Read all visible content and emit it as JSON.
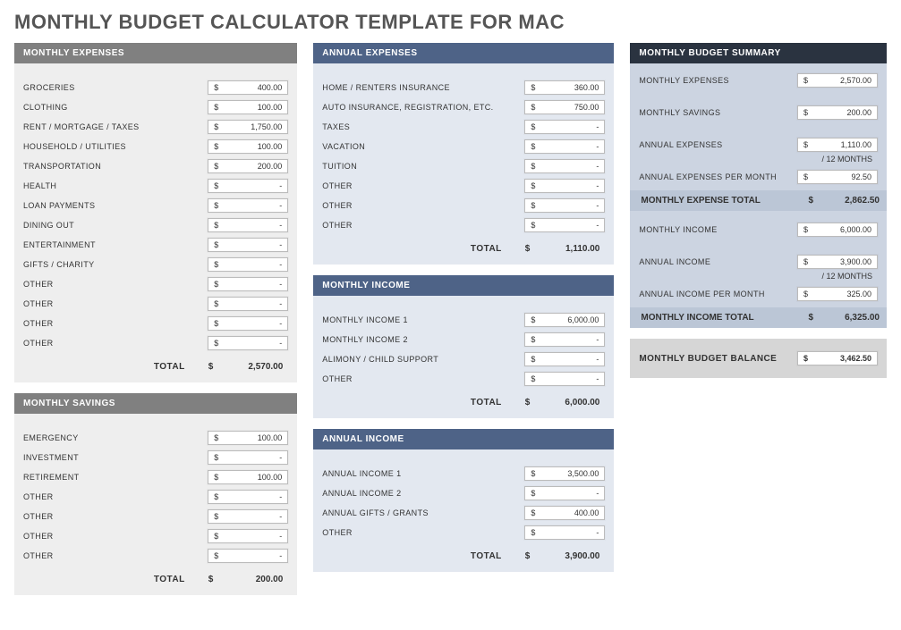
{
  "title": "MONTHLY BUDGET CALCULATOR TEMPLATE FOR MAC",
  "currency": "$",
  "dash": "-",
  "labels": {
    "total": "TOTAL",
    "per12": "/ 12 MONTHS"
  },
  "monthly_expenses": {
    "heading": "MONTHLY EXPENSES",
    "rows": [
      {
        "label": "GROCERIES",
        "value": "400.00"
      },
      {
        "label": "CLOTHING",
        "value": "100.00"
      },
      {
        "label": "RENT / MORTGAGE / TAXES",
        "value": "1,750.00"
      },
      {
        "label": "HOUSEHOLD / UTILITIES",
        "value": "100.00"
      },
      {
        "label": "TRANSPORTATION",
        "value": "200.00"
      },
      {
        "label": "HEALTH",
        "value": "-"
      },
      {
        "label": "LOAN PAYMENTS",
        "value": "-"
      },
      {
        "label": "DINING OUT",
        "value": "-"
      },
      {
        "label": "ENTERTAINMENT",
        "value": "-"
      },
      {
        "label": "GIFTS / CHARITY",
        "value": "-"
      },
      {
        "label": "OTHER",
        "value": "-"
      },
      {
        "label": "OTHER",
        "value": "-"
      },
      {
        "label": "OTHER",
        "value": "-"
      },
      {
        "label": "OTHER",
        "value": "-"
      }
    ],
    "total": "2,570.00"
  },
  "monthly_savings": {
    "heading": "MONTHLY SAVINGS",
    "rows": [
      {
        "label": "EMERGENCY",
        "value": "100.00"
      },
      {
        "label": "INVESTMENT",
        "value": "-"
      },
      {
        "label": "RETIREMENT",
        "value": "100.00"
      },
      {
        "label": "OTHER",
        "value": "-"
      },
      {
        "label": "OTHER",
        "value": "-"
      },
      {
        "label": "OTHER",
        "value": "-"
      },
      {
        "label": "OTHER",
        "value": "-"
      }
    ],
    "total": "200.00"
  },
  "annual_expenses": {
    "heading": "ANNUAL EXPENSES",
    "rows": [
      {
        "label": "HOME / RENTERS INSURANCE",
        "value": "360.00"
      },
      {
        "label": "AUTO INSURANCE, REGISTRATION, ETC.",
        "value": "750.00"
      },
      {
        "label": "TAXES",
        "value": "-"
      },
      {
        "label": "VACATION",
        "value": "-"
      },
      {
        "label": "TUITION",
        "value": "-"
      },
      {
        "label": "OTHER",
        "value": "-"
      },
      {
        "label": "OTHER",
        "value": "-"
      },
      {
        "label": "OTHER",
        "value": "-"
      }
    ],
    "total": "1,110.00"
  },
  "monthly_income": {
    "heading": "MONTHLY INCOME",
    "rows": [
      {
        "label": "MONTHLY INCOME 1",
        "value": "6,000.00"
      },
      {
        "label": "MONTHLY INCOME 2",
        "value": "-"
      },
      {
        "label": "ALIMONY / CHILD SUPPORT",
        "value": "-"
      },
      {
        "label": "OTHER",
        "value": "-"
      }
    ],
    "total": "6,000.00"
  },
  "annual_income": {
    "heading": "ANNUAL INCOME",
    "rows": [
      {
        "label": "ANNUAL INCOME 1",
        "value": "3,500.00"
      },
      {
        "label": "ANNUAL INCOME 2",
        "value": "-"
      },
      {
        "label": "ANNUAL GIFTS / GRANTS",
        "value": "400.00"
      },
      {
        "label": "OTHER",
        "value": "-"
      }
    ],
    "total": "3,900.00"
  },
  "summary": {
    "heading": "MONTHLY BUDGET SUMMARY",
    "monthly_expenses": {
      "label": "MONTHLY EXPENSES",
      "value": "2,570.00"
    },
    "monthly_savings": {
      "label": "MONTHLY SAVINGS",
      "value": "200.00"
    },
    "annual_expenses": {
      "label": "ANNUAL EXPENSES",
      "value": "1,110.00"
    },
    "annual_expenses_pm": {
      "label": "ANNUAL EXPENSES PER MONTH",
      "value": "92.50"
    },
    "expense_total": {
      "label": "MONTHLY EXPENSE TOTAL",
      "value": "2,862.50"
    },
    "monthly_income": {
      "label": "MONTHLY INCOME",
      "value": "6,000.00"
    },
    "annual_income": {
      "label": "ANNUAL INCOME",
      "value": "3,900.00"
    },
    "annual_income_pm": {
      "label": "ANNUAL INCOME PER MONTH",
      "value": "325.00"
    },
    "income_total": {
      "label": "MONTHLY INCOME TOTAL",
      "value": "6,325.00"
    }
  },
  "balance": {
    "label": "MONTHLY BUDGET BALANCE",
    "value": "3,462.50"
  }
}
